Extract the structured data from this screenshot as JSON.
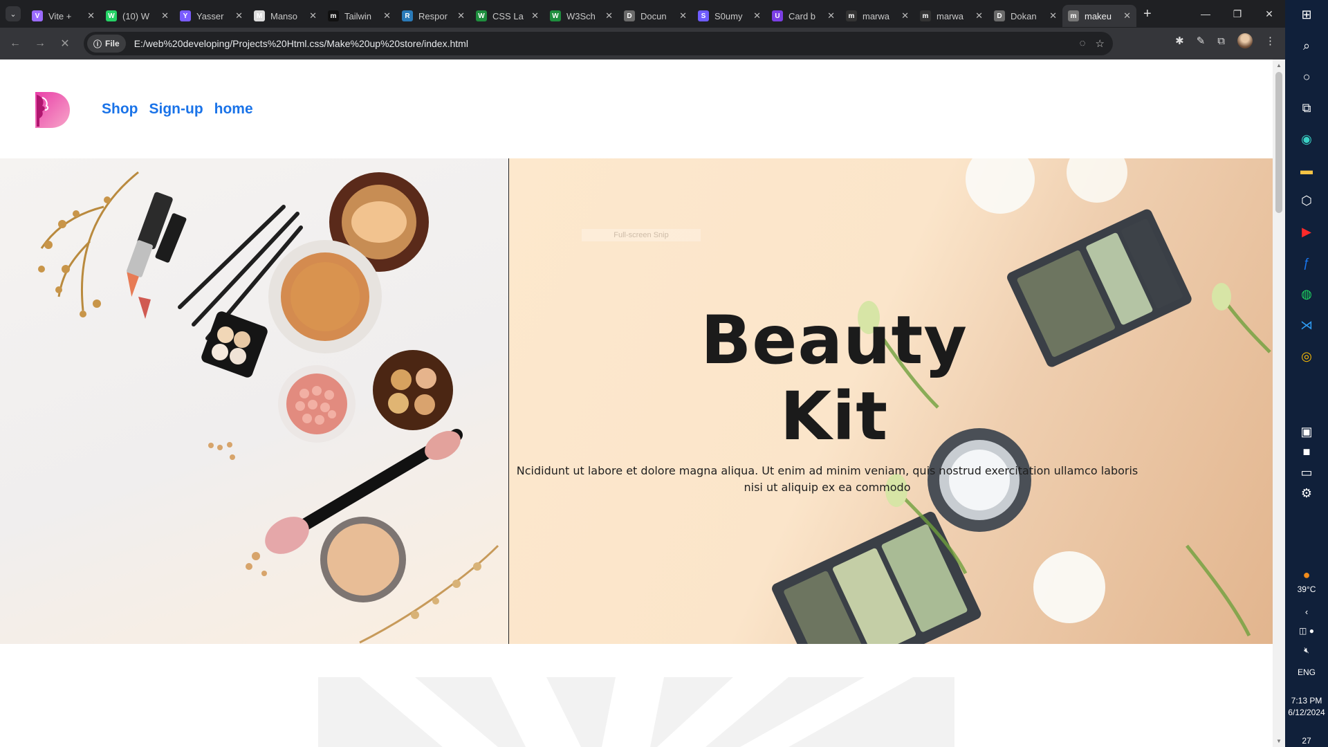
{
  "browser": {
    "tabs": [
      {
        "title": "Vite +",
        "color": "#9b6bff",
        "glyph": "V"
      },
      {
        "title": "(10) W",
        "color": "#25d366",
        "glyph": "W"
      },
      {
        "title": "Yasser",
        "color": "#7a5cff",
        "glyph": "Y"
      },
      {
        "title": "Manso",
        "color": "#dcdcdc",
        "glyph": "M"
      },
      {
        "title": "Tailwin",
        "color": "#111111",
        "glyph": "m"
      },
      {
        "title": "Respor",
        "color": "#2a7ab8",
        "glyph": "R"
      },
      {
        "title": "CSS La",
        "color": "#1e8e3e",
        "glyph": "W"
      },
      {
        "title": "W3Sch",
        "color": "#1e8e3e",
        "glyph": "W"
      },
      {
        "title": "Docun",
        "color": "#6b6b6b",
        "glyph": "D"
      },
      {
        "title": "S0umy",
        "color": "#6e5cff",
        "glyph": "S"
      },
      {
        "title": "Card b",
        "color": "#7b3fe4",
        "glyph": "U"
      },
      {
        "title": "marwa",
        "color": "#333333",
        "glyph": "m"
      },
      {
        "title": "marwa",
        "color": "#333333",
        "glyph": "m"
      },
      {
        "title": "Dokan",
        "color": "#6b6b6b",
        "glyph": "D"
      },
      {
        "title": "makeu",
        "color": "#777777",
        "glyph": "m",
        "active": true
      }
    ],
    "new_tab": "+",
    "window_controls": {
      "minimize": "—",
      "restore": "❐",
      "close": "✕"
    },
    "address": {
      "chip": "File",
      "url": "E:/web%20developing/Projects%20Html.css/Make%20up%20store/index.html"
    }
  },
  "site": {
    "nav": [
      "Shop",
      "Sign-up",
      "home"
    ],
    "hero": {
      "watermark": "Full-screen Snip",
      "title_line1": "Beauty",
      "title_line2": "Kit",
      "text": "Ncididunt ut labore et dolore magna aliqua. Ut enim ad minim veniam, quis nostrud exercitation ullamco laboris nisi ut aliquip ex ea commodo"
    }
  },
  "taskbar": {
    "weather": "39°C",
    "language": "ENG",
    "time": "7:13 PM",
    "date": "6/12/2024",
    "notifications": "27"
  }
}
